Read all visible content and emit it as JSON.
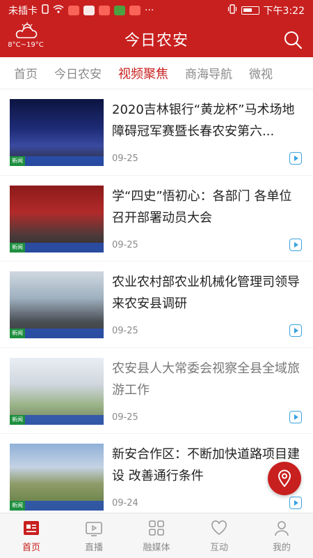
{
  "status_bar": {
    "carrier": "未插卡",
    "time": "下午3:22"
  },
  "header": {
    "weather": "8°C~19°C",
    "title": "今日农安"
  },
  "tabs": [
    {
      "label": "首页"
    },
    {
      "label": "今日农安"
    },
    {
      "label": "视频聚焦"
    },
    {
      "label": "商海导航"
    },
    {
      "label": "微视"
    }
  ],
  "news": [
    {
      "title": "2020吉林银行“黄龙杯”马术场地障碍冠军赛暨长春农安第六...",
      "date": "09-25"
    },
    {
      "title": "学“四史”悟初心：各部门 各单位召开部署动员大会",
      "date": "09-25"
    },
    {
      "title": "农业农村部农业机械化管理司领导来农安县调研",
      "date": "09-25"
    },
    {
      "title": "农安县人大常委会视察全县全域旅游工作",
      "date": "09-25"
    },
    {
      "title": "新安合作区：不断加快道路项目建设 改善通行条件",
      "date": "09-24"
    }
  ],
  "thumb_tag": "新闻",
  "bottom_nav": [
    {
      "label": "首页"
    },
    {
      "label": "直播"
    },
    {
      "label": "融媒体"
    },
    {
      "label": "互动"
    },
    {
      "label": "我的"
    }
  ],
  "colors": {
    "brand": "#c8201f",
    "accent": "#3aa3e0"
  }
}
